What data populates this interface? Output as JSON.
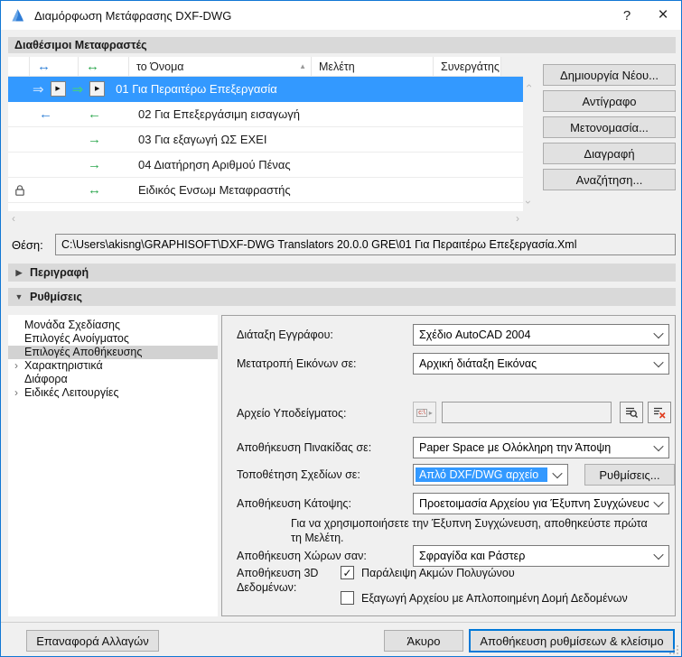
{
  "colors": {
    "accent": "#0078d7",
    "selection_blue": "#3399ff",
    "arrow_blue": "#2f7fd6",
    "arrow_green": "#2ca84e",
    "bar_gray": "#d9d9d9",
    "button_gray": "#e1e1e1"
  },
  "window": {
    "title": "Διαμόρφωση Μετάφρασης DXF-DWG"
  },
  "icons": {
    "help": "?",
    "close": "×",
    "sort_asc": "▲",
    "collapsed": "▶",
    "expanded": "▼",
    "tree_expander": "›",
    "scroll_chevron": "›",
    "scroll_chevron_left": "‹",
    "play": "▶",
    "check": "✓",
    "drive": "c:\\",
    "drive_more": "▸"
  },
  "translators": {
    "section_label": "Διαθέσιμοι Μεταφραστές",
    "columns": {
      "arrow_in": "↔",
      "arrow_out": "↔",
      "name": "το Όνομα",
      "project": "Μελέτη",
      "partner": "Συνεργάτης"
    },
    "rows": [
      {
        "name": "01 Για Περαιτέρω Επεξεργασία",
        "in_arrow": "⇒",
        "out_arrow": "⇒",
        "project": "",
        "partner": "",
        "selected": true
      },
      {
        "name": "02 Για Επεξεργάσιμη εισαγωγή",
        "in_arrow": "←",
        "out_arrow": "←",
        "project": "",
        "partner": ""
      },
      {
        "name": "03 Για εξαγωγή ΩΣ ΕΧΕΙ",
        "in_arrow": "",
        "out_arrow": "→",
        "project": "",
        "partner": ""
      },
      {
        "name": "04 Διατήρηση Αριθμού Πένας",
        "in_arrow": "",
        "out_arrow": "→",
        "project": "",
        "partner": ""
      },
      {
        "name": "Ειδικός Ενσωμ Μεταφραστής",
        "in_arrow": "",
        "out_arrow": "↔",
        "project": "",
        "partner": "",
        "locked": true
      }
    ],
    "actions": [
      "Δημιουργία Νέου...",
      "Αντίγραφο",
      "Μετονομασία...",
      "Διαγραφή",
      "Αναζήτηση..."
    ]
  },
  "location": {
    "label": "Θέση:",
    "path": "C:\\Users\\akisng\\GRAPHISOFT\\DXF-DWG Translators 20.0.0 GRE\\01 Για Περαιτέρω Επεξεργασία.Xml"
  },
  "sections": {
    "description": "Περιγραφή",
    "settings": "Ρυθμίσεις"
  },
  "settings_nav": {
    "items": [
      {
        "label": "Μονάδα Σχεδίασης"
      },
      {
        "label": "Επιλογές Ανοίγματος"
      },
      {
        "label": "Επιλογές Αποθήκευσης",
        "selected": true
      },
      {
        "label": "Χαρακτηριστικά",
        "expandable": true
      },
      {
        "label": "Διάφορα"
      },
      {
        "label": "Ειδικές Λειτουργίες",
        "expandable": true
      }
    ]
  },
  "form": {
    "document_layout": {
      "label": "Διάταξη Εγγράφου:",
      "value": "Σχέδιο AutoCAD 2004"
    },
    "image_conversion": {
      "label": "Μετατροπή Εικόνων σε:",
      "value": "Αρχική διάταξη Εικόνας"
    },
    "template_file": {
      "label": "Αρχείο Υποδείγματος:",
      "value": ""
    },
    "layout_save": {
      "label": "Αποθήκευση Πινακίδας σε:",
      "value": "Paper Space με Ολόκληρη την Άποψη"
    },
    "drawing_placement": {
      "label": "Τοποθέτηση Σχεδίων σε:",
      "value": "Απλό DXF/DWG αρχείο",
      "settings_button": "Ρυθμίσεις..."
    },
    "floorplan_save": {
      "label": "Αποθήκευση Κάτοψης:",
      "value": "Προετοιμασία Αρχείου για Έξυπνη Συγχώνευση",
      "note": "Για να χρησιμοποιήσετε την Έξυπνη Συγχώνευση, αποθηκεύστε πρώτα τη Μελέτη."
    },
    "zone_save": {
      "label": "Αποθήκευση Χώρων σαν:",
      "value": "Σφραγίδα και Ράστερ"
    },
    "data3d": {
      "label": "Αποθήκευση 3D Δεδομένων:",
      "checkbox1": {
        "label": "Παράλειψη Ακμών Πολυγώνου",
        "checked": true
      },
      "checkbox2": {
        "label": "Εξαγωγή Αρχείου με Απλοποιημένη Δομή Δεδομένων",
        "checked": false
      }
    }
  },
  "footer": {
    "reset": "Επαναφορά Αλλαγών",
    "cancel": "Άκυρο",
    "save": "Αποθήκευση ρυθμίσεων & κλείσιμο"
  }
}
